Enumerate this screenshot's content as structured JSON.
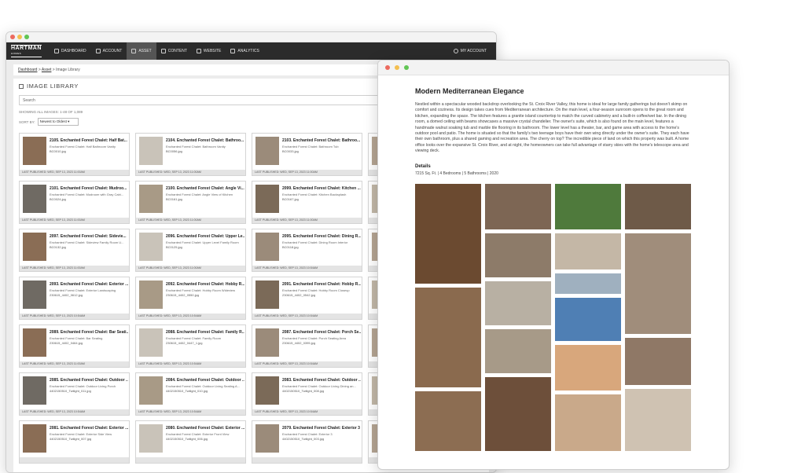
{
  "back_window": {
    "nav": {
      "logo": "HARTMAN",
      "logo_sub": "HOMES",
      "items": [
        "DASHBOARD",
        "ACCOUNT",
        "ASSET",
        "CONTENT",
        "WEBSITE",
        "ANALYTICS"
      ],
      "active": "ASSET",
      "account": "MY ACCOUNT"
    },
    "breadcrumb": {
      "dashboard": "Dashboard",
      "asset": "Asset",
      "sep": " > ",
      "current": "Image Library"
    },
    "library": {
      "title": "IMAGE LIBRARY",
      "search_placeholder": "Search",
      "showing": "SHOWING ALL IMAGES: 1-48 OF 1,089",
      "sort_label": "SORT BY:",
      "sort_value": "Newest to Oldest"
    },
    "cards": [
      {
        "title": "2105. Enchanted Forest Chalet: Half Bat...",
        "desc": "Enchanted Forest Chalet: Half Bathroom Vanity",
        "file": "BC0010.jpg",
        "foot": "LAST PUBLISHED: WED, SEP 13, 2023 11:00AM"
      },
      {
        "title": "2104. Enchanted Forest Chalet: Bathroo...",
        "desc": "Enchanted Forest Chalet: Bathroom Vanity",
        "file": "BC0056.jpg",
        "foot": "LAST PUBLISHED: WED, SEP 13, 2023 11:00AM"
      },
      {
        "title": "2103. Enchanted Forest Chalet: Bathroo...",
        "desc": "Enchanted Forest Chalet: Bathroom Tub",
        "file": "BC0033.jpg",
        "foot": "LAST PUBLISHED: WED, SEP 13, 2023 11:00AM"
      },
      {
        "title": "",
        "desc": "",
        "file": "",
        "foot": ""
      },
      {
        "title": "2101. Enchanted Forest Chalet: Mudroo...",
        "desc": "Enchanted Forest Chalet: Mudroom with Gray Cabi...",
        "file": "BC0024.jpg",
        "foot": "LAST PUBLISHED: WED, SEP 13, 2023 11:00AM"
      },
      {
        "title": "2100. Enchanted Forest Chalet: Angle Vi...",
        "desc": "Enchanted Forest Chalet: Angle View of Kitchen",
        "file": "BC0161.jpg",
        "foot": "LAST PUBLISHED: WED, SEP 13, 2023 11:00AM"
      },
      {
        "title": "2099. Enchanted Forest Chalet: Kitchen ...",
        "desc": "Enchanted Forest Chalet: Kitchen Backsplash",
        "file": "BC0167.jpg",
        "foot": "LAST PUBLISHED: WED, SEP 13, 2023 11:00AM"
      },
      {
        "title": "",
        "desc": "",
        "file": "",
        "foot": ""
      },
      {
        "title": "2097. Enchanted Forest Chalet: Sidevie...",
        "desc": "Enchanted Forest Chalet: Sideview Family Room U...",
        "file": "BC0132.jpg",
        "foot": "LAST PUBLISHED: WED, SEP 13, 2023 11:00AM"
      },
      {
        "title": "2096. Enchanted Forest Chalet: Upper Le...",
        "desc": "Enchanted Forest Chalet: Upper Level Family Room",
        "file": "BC0125.jpg",
        "foot": "LAST PUBLISHED: WED, SEP 13, 2023 11:00AM"
      },
      {
        "title": "2095. Enchanted Forest Chalet: Dining R...",
        "desc": "Enchanted Forest Chalet: Dining Room Interior",
        "file": "BC0118.jpg",
        "foot": "LAST PUBLISHED: WED, SEP 13, 2023 10:54AM"
      },
      {
        "title": "",
        "desc": "",
        "file": "",
        "foot": ""
      },
      {
        "title": "2093. Enchanted Forest Chalet: Exterior ...",
        "desc": "Enchanted Forest Chalet: Exterior Landscaping",
        "file": "230615_4402_0612.jpg",
        "foot": "LAST PUBLISHED: WED, SEP 13, 2023 10:54AM"
      },
      {
        "title": "2092. Enchanted Forest Chalet: Hobby R...",
        "desc": "Enchanted Forest Chalet: Hobby Room Wideview",
        "file": "230615_4402_0550.jpg",
        "foot": "LAST PUBLISHED: WED, SEP 13, 2023 10:54AM"
      },
      {
        "title": "2091. Enchanted Forest Chalet: Hobby R...",
        "desc": "Enchanted Forest Chalet: Hobby Room Closeup",
        "file": "230615_4402_0542.jpg",
        "foot": "LAST PUBLISHED: WED, SEP 13, 2023 10:54AM"
      },
      {
        "title": "",
        "desc": "",
        "file": "",
        "foot": ""
      },
      {
        "title": "2089. Enchanted Forest Chalet: Bar Seati...",
        "desc": "Enchanted Forest Chalet: Bar Seating",
        "file": "230615_4402_0464.jpg",
        "foot": "LAST PUBLISHED: WED, SEP 13, 2023 11:00AM"
      },
      {
        "title": "2088. Enchanted Forest Chalet: Family R...",
        "desc": "Enchanted Forest Chalet: Family Room",
        "file": "230615_4402_0447_1.jpg",
        "foot": "LAST PUBLISHED: WED, SEP 13, 2023 10:54AM"
      },
      {
        "title": "2087. Enchanted Forest Chalet: Porch Se...",
        "desc": "Enchanted Forest Chalet: Porch Seating Area",
        "file": "230615_4402_0395.jpg",
        "foot": "LAST PUBLISHED: WED, SEP 13, 2023 10:54AM"
      },
      {
        "title": "",
        "desc": "",
        "file": "",
        "foot": ""
      },
      {
        "title": "2085. Enchanted Forest Chalet: Outdoor ...",
        "desc": "Enchanted Forest Chalet: Outdoor Living Porch",
        "file": "4402150510_Twilight_011.jpg",
        "foot": "LAST PUBLISHED: WED, SEP 13, 2023 10:54AM"
      },
      {
        "title": "2084. Enchanted Forest Chalet: Outdoor ...",
        "desc": "Enchanted Forest Chalet: Outdoor Living Seating A...",
        "file": "4402150510_Twilight_010.jpg",
        "foot": "LAST PUBLISHED: WED, SEP 13, 2023 10:54AM"
      },
      {
        "title": "2083. Enchanted Forest Chalet: Outdoor ...",
        "desc": "Enchanted Forest Chalet: Outdoor Living Dining an...",
        "file": "4402150510_Twilight_008.jpg",
        "foot": "LAST PUBLISHED: WED, SEP 13, 2023 10:54AM"
      },
      {
        "title": "",
        "desc": "",
        "file": "",
        "foot": ""
      },
      {
        "title": "2081. Enchanted Forest Chalet: Exterior ...",
        "desc": "Enchanted Forest Chalet: Exterior Side View",
        "file": "4402150510_Twilight_007.jpg",
        "foot": ""
      },
      {
        "title": "2080. Enchanted Forest Chalet: Exterior ...",
        "desc": "Enchanted Forest Chalet: Exterior Front View",
        "file": "4402150510_Twilight_006.jpg",
        "foot": ""
      },
      {
        "title": "2079. Enchanted Forest Chalet: Exterior 3",
        "desc": "Enchanted Forest Chalet: Exterior 3",
        "file": "4402150510_Twilight_003.jpg",
        "foot": ""
      },
      {
        "title": "",
        "desc": "",
        "file": "",
        "foot": ""
      }
    ]
  },
  "front_window": {
    "title": "Modern Mediterranean Elegance",
    "description": "Nestled within a spectacular wooded backdrop overlooking the St. Croix River Valley, this home is ideal for large family gatherings but doesn't skimp on comfort and coziness. Its design takes cues from Mediterranean architecture. On the main level, a four-season sunroom opens to the great room and kitchen, expanding the space. The kitchen features a granite island countertop to match the curved cabinetry and a built-in coffee/wet bar. In the dining room, a domed ceiling with beams showcases a massive crystal chandelier. The owner's suite, which is also found on the main level, features a handmade walnut soaking tub and marble tile flooring in its bathroom. The lower level has a theater, bar, and game area with access to the home's outdoor pool and patio. The home is situated so that the family's two teenage boys have their own wing directly under the owner's suite. They each have their own bathroom, plus a shared gaming and recreation area. The cherry on top? The incredible piece of land on which this property was built. A home office looks over the expansive St. Croix River, and at night, the homeowners can take full advantage of starry skies with the home's telescope area and viewing deck.",
    "details_title": "Details",
    "details_text": "7215 Sq. Ft. | 4 Bedrooms | 5 Bathrooms | 2020"
  },
  "colors": {
    "nav_bg": "#2b2b2b",
    "dot_red": "#ec6a5e",
    "dot_yellow": "#f4bf4f",
    "dot_green": "#61c554"
  }
}
